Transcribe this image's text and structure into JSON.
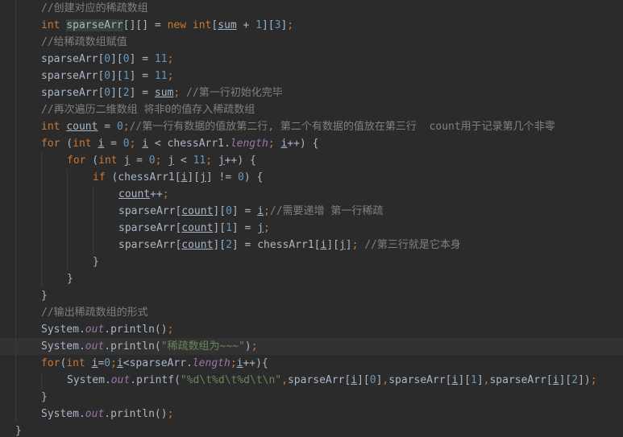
{
  "editor": {
    "lines": [
      {
        "indent": 1,
        "code": "//创建对应的稀疏数组"
      },
      {
        "indent": 1,
        "code": "int sparseArr[][] = new int[sum + 1][3];"
      },
      {
        "indent": 1,
        "code": "//给稀疏数组赋值"
      },
      {
        "indent": 1,
        "code": "sparseArr[0][0] = 11;"
      },
      {
        "indent": 1,
        "code": "sparseArr[0][1] = 11;"
      },
      {
        "indent": 1,
        "code": "sparseArr[0][2] = sum; //第一行初始化完毕"
      },
      {
        "indent": 1,
        "code": "//再次遍历二维数组 将非0的值存入稀疏数组"
      },
      {
        "indent": 1,
        "code": "int count = 0;//第一行有数据的值放第二行, 第二个有数据的值放在第三行  count用于记录第几个非零"
      },
      {
        "indent": 1,
        "code": "for (int i = 0; i < chessArr1.length; i++) {"
      },
      {
        "indent": 2,
        "code": "for (int j = 0; j < 11; j++) {"
      },
      {
        "indent": 3,
        "code": "if (chessArr1[i][j] != 0) {"
      },
      {
        "indent": 4,
        "code": "count++;"
      },
      {
        "indent": 4,
        "code": "sparseArr[count][0] = i;//需要递增 第一行稀疏"
      },
      {
        "indent": 4,
        "code": "sparseArr[count][1] = j;"
      },
      {
        "indent": 4,
        "code": "sparseArr[count][2] = chessArr1[i][j]; //第三行就是它本身"
      },
      {
        "indent": 3,
        "code": "}"
      },
      {
        "indent": 2,
        "code": "}"
      },
      {
        "indent": 1,
        "code": "}"
      },
      {
        "indent": 1,
        "code": "//输出稀疏数组的形式"
      },
      {
        "indent": 1,
        "code": "System.out.println();"
      },
      {
        "indent": 1,
        "code": "System.out.println(\"稀疏数组为~~~\");"
      },
      {
        "indent": 1,
        "code": "for(int i=0;i<sparseArr.length;i++){"
      },
      {
        "indent": 2,
        "code": "System.out.printf(\"%d\\t%d\\t%d\\t\\n\",sparseArr[i][0],sparseArr[i][1],sparseArr[i][2]);"
      },
      {
        "indent": 1,
        "code": "}"
      },
      {
        "indent": 1,
        "code": "System.out.println();"
      },
      {
        "indent": 0,
        "code": "}"
      }
    ],
    "current_line": 20
  },
  "colors": {
    "background": "#2b2b2b",
    "current_line": "#323232",
    "text": "#a9b7c6",
    "keyword": "#cc7832",
    "number": "#6897bb",
    "comment": "#808080",
    "string": "#6a8759",
    "field": "#9876aa"
  }
}
